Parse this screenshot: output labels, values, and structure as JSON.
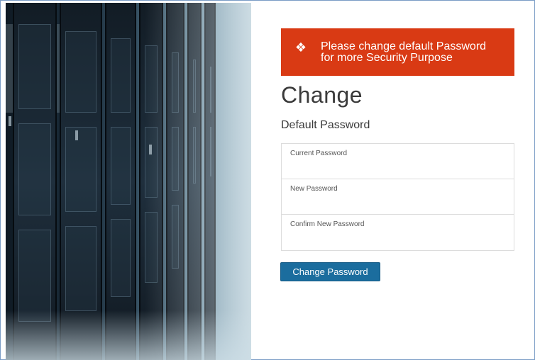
{
  "alert": {
    "icon": "warning-diamond-icon",
    "line1": "Please change default Password",
    "line2": "for more Security Purpose",
    "color": "#d93a14"
  },
  "heading": {
    "title": "Change",
    "subtitle": "Default Password"
  },
  "form": {
    "current_password_label": "Current Password",
    "new_password_label": "New Password",
    "confirm_password_label": "Confirm New Password"
  },
  "submit": {
    "label": "Change Password",
    "color": "#1b6d9e"
  }
}
